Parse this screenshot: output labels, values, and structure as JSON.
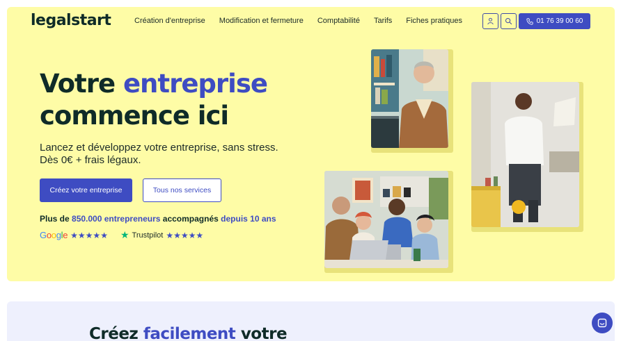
{
  "brand": {
    "logo": "legalstart"
  },
  "nav": {
    "items": [
      {
        "label": "Création d'entreprise"
      },
      {
        "label": "Modification et fermeture"
      },
      {
        "label": "Comptabilité"
      },
      {
        "label": "Tarifs"
      },
      {
        "label": "Fiches pratiques"
      }
    ],
    "account_icon": "user-icon",
    "search_icon": "search-icon",
    "phone": "01 76 39 00 60"
  },
  "hero": {
    "headline_part1": "Votre",
    "headline_accent": "entreprise",
    "headline_part2": "commence ici",
    "subline_1": "Lancez et développez votre entreprise, sans stress.",
    "subline_2": "Dès 0€ + frais légaux.",
    "cta_primary": "Créez votre entreprise",
    "cta_secondary": "Tous nos services",
    "stats": {
      "prefix": "Plus de",
      "count": "850.000 entrepreneurs",
      "middle": "accompagnés",
      "since": "depuis 10 ans"
    },
    "ratings": {
      "google_label": "Google",
      "google_stars": "★★★★★",
      "google_rating": 4.5,
      "trustpilot_label": "Trustpilot",
      "trustpilot_stars": "★★★★★",
      "trustpilot_rating": 4.5
    }
  },
  "section2": {
    "title_part1": "Créez",
    "title_accent": "facilement",
    "title_part2": "votre"
  },
  "colors": {
    "accent": "#3e4cc2",
    "hero_bg": "#fefca6",
    "section_bg": "#eef0fd",
    "text_dark": "#0f2b28",
    "trustpilot_green": "#00b67a"
  }
}
